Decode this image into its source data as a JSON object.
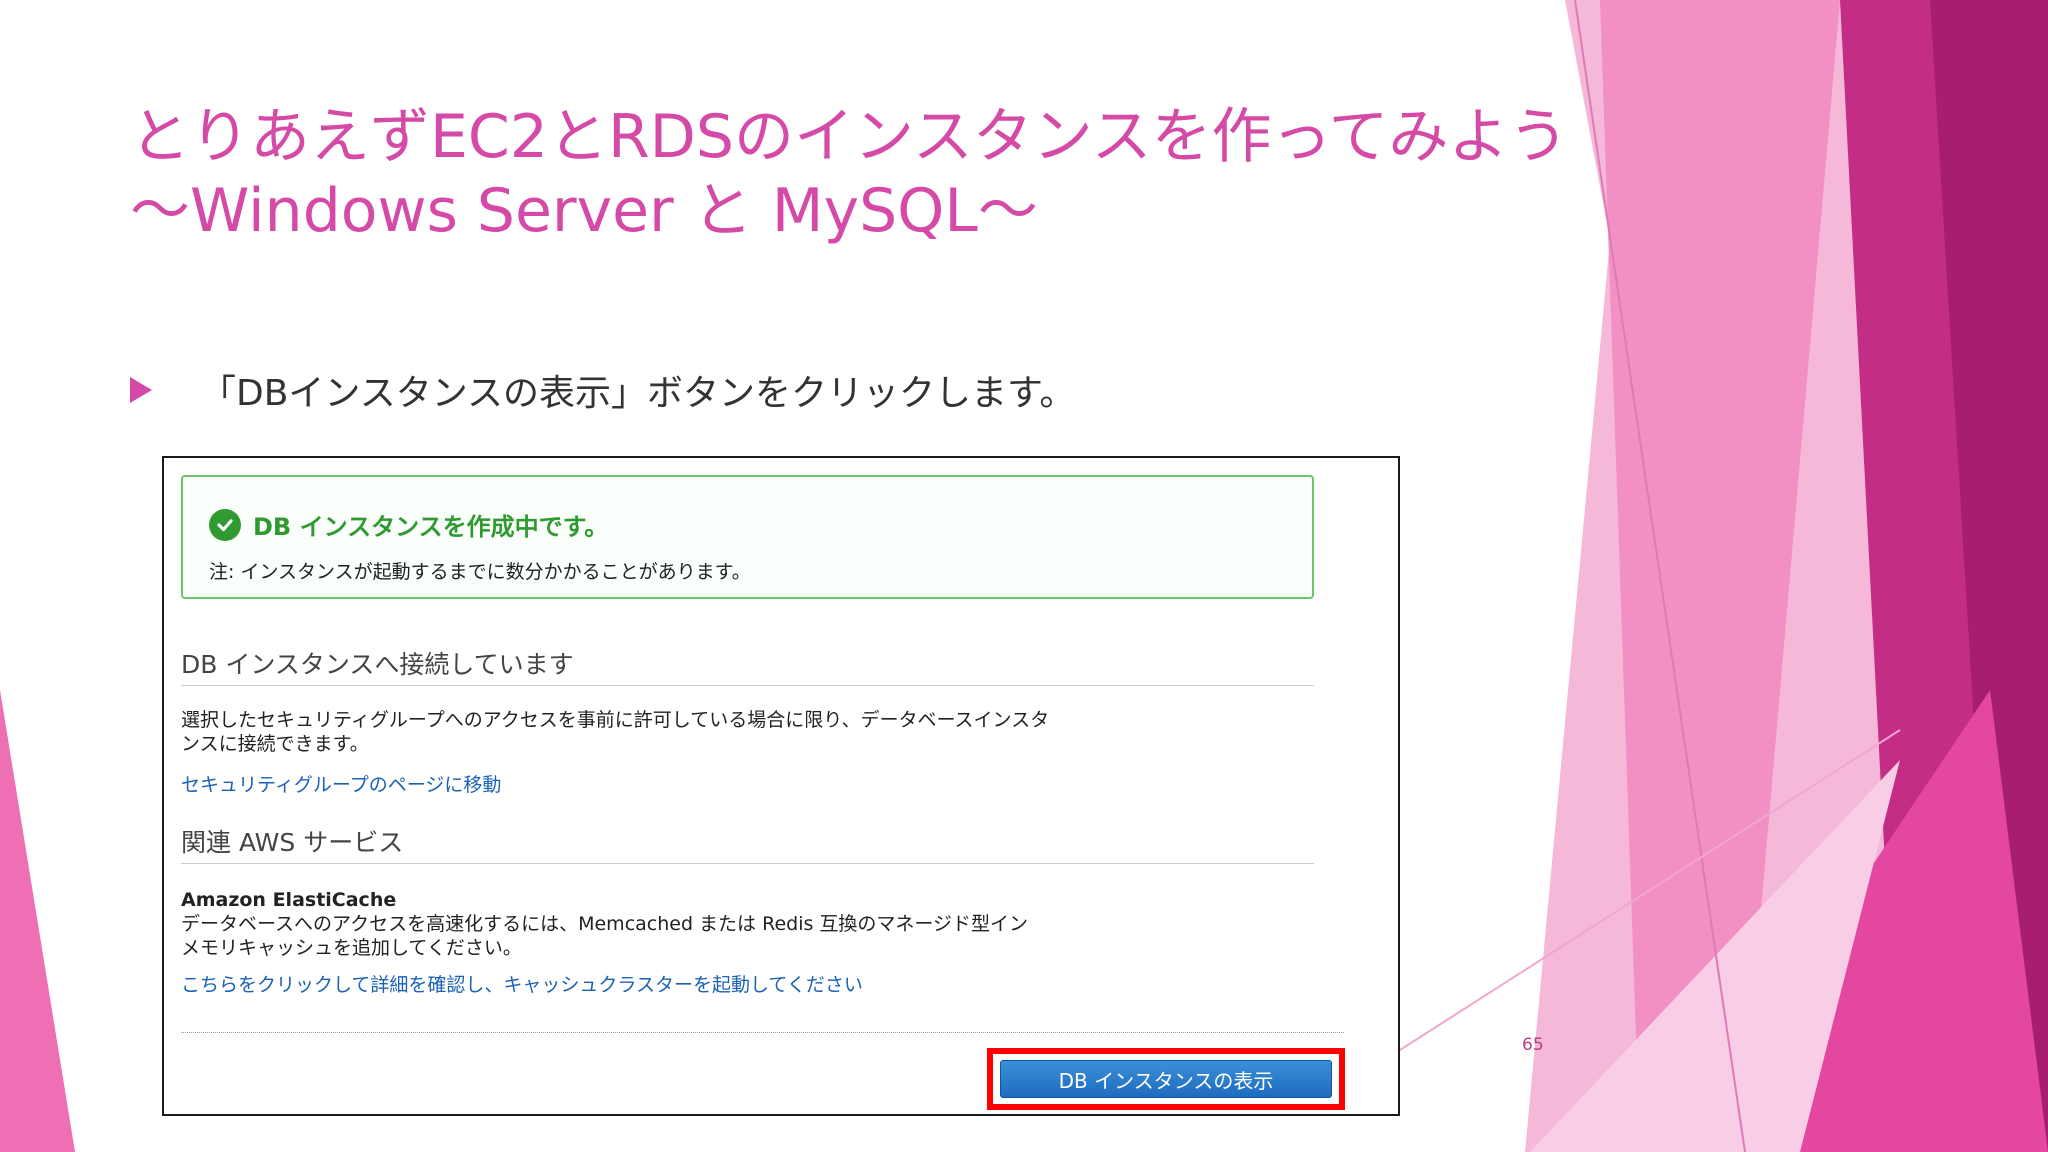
{
  "slide": {
    "title_line1": "とりあえずEC2とRDSのインスタンスを作ってみよう",
    "title_line2": "～Windows Server と MySQL～",
    "bullet": "「DBインスタンスの表示」ボタンをクリックします。",
    "page_number": "65",
    "accent_color": "#d44aa6"
  },
  "screenshot": {
    "alert": {
      "icon": "check-circle-icon",
      "title": "DB インスタンスを作成中です。",
      "note": "注: インスタンスが起動するまでに数分かかることがあります。"
    },
    "connect_section": {
      "heading": "DB インスタンスへ接続しています",
      "body_line1": "選択したセキュリティグループへのアクセスを事前に許可している場合に限り、データベースインスタ",
      "body_line2": "ンスに接続できます。",
      "link": "セキュリティグループのページに移動"
    },
    "related_section": {
      "heading": "関連 AWS サービス",
      "service_name": "Amazon ElastiCache",
      "desc_line1": "データベースへのアクセスを高速化するには、Memcached または Redis 互換のマネージド型イン",
      "desc_line2": "メモリキャッシュを追加してください。",
      "link": "こちらをクリックして詳細を確認し、キャッシュクラスターを起動してください"
    },
    "view_button_label": "DB インスタンスの表示"
  }
}
